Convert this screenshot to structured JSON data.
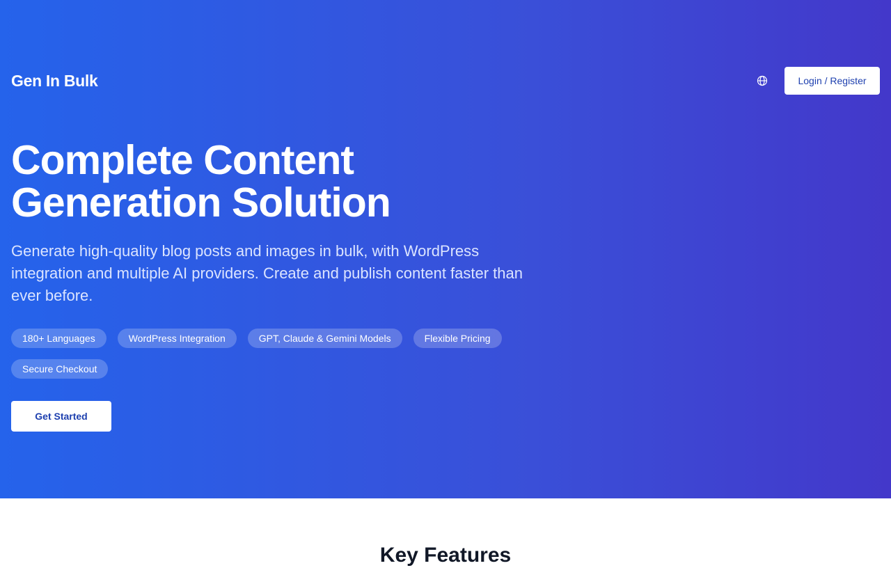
{
  "header": {
    "brand": "Gen In Bulk",
    "language_icon": "globe-icon",
    "login_label": "Login / Register"
  },
  "hero": {
    "title_line1": "Complete Content",
    "title_line2": "Generation Solution",
    "subtitle": "Generate high-quality blog posts and images in bulk, with WordPress integration and multiple AI providers. Create and publish content faster than ever before.",
    "tags": [
      "180+ Languages",
      "WordPress Integration",
      "GPT, Claude & Gemini Models",
      "Flexible Pricing",
      "Secure Checkout"
    ],
    "cta_label": "Get Started"
  },
  "features": {
    "title": "Key Features"
  },
  "colors": {
    "gradient_start": "#2563eb",
    "gradient_end": "#4338ca",
    "button_text": "#1e40af"
  }
}
